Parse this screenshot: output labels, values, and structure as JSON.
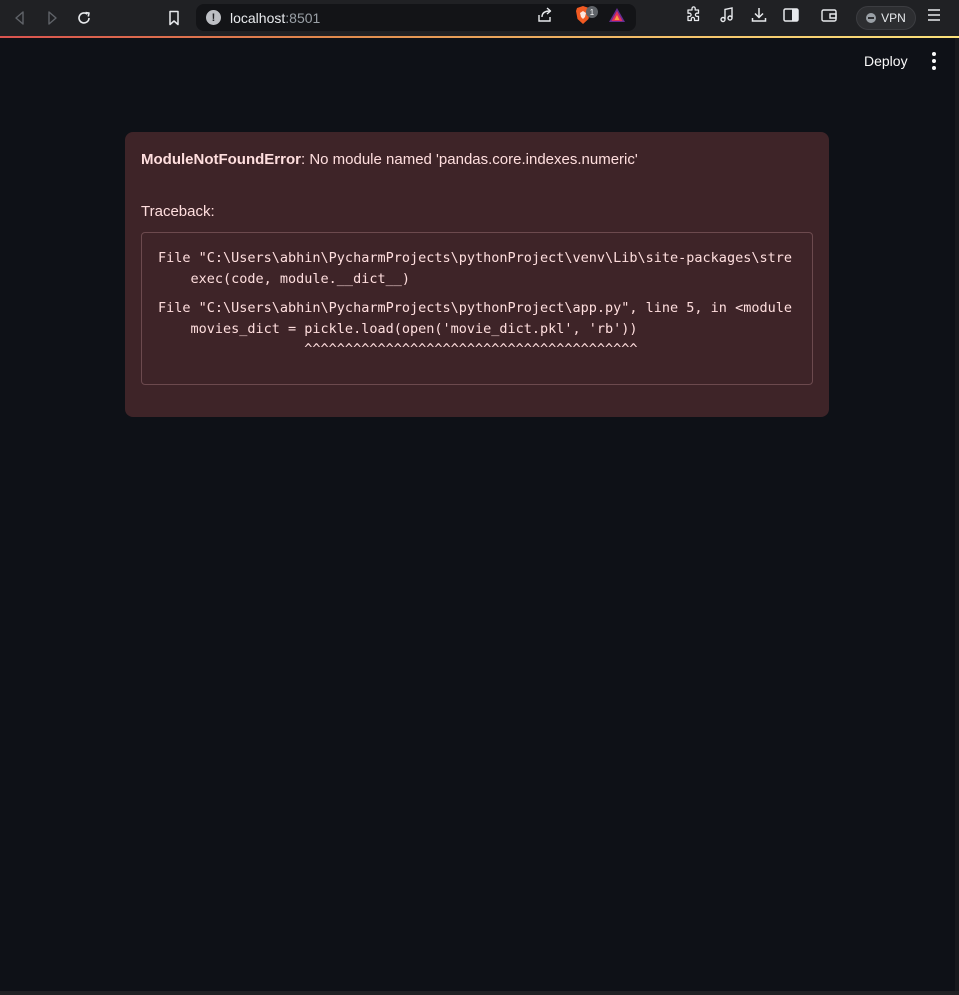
{
  "browser": {
    "url_host": "localhost",
    "url_port": ":8501",
    "brave_badge": "1",
    "vpn_label": "VPN",
    "colors": {
      "toolbar_bg": "#202124",
      "url_bg": "#131417",
      "accent_gradient": [
        "#d9534f",
        "#fbe27b"
      ]
    },
    "icons": [
      "back-icon",
      "forward-icon",
      "reload-icon",
      "bookmark-icon",
      "info-icon",
      "share-icon",
      "brave-shield-icon",
      "brave-rewards-icon",
      "extensions-icon",
      "media-icon",
      "download-icon",
      "sidebar-icon",
      "wallet-icon",
      "vpn-icon",
      "menu-icon"
    ]
  },
  "app": {
    "deploy_label": "Deploy",
    "colors": {
      "background": "#0e1117",
      "error_bg": "#3e2428",
      "error_text": "#ffdede"
    },
    "error": {
      "type": "ModuleNotFoundError",
      "message": ": No module named 'pandas.core.indexes.numeric'",
      "traceback_label": "Traceback:",
      "traceback_lines": [
        "File \"C:\\Users\\abhin\\PycharmProjects\\pythonProject\\venv\\Lib\\site-packages\\stre",
        "    exec(code, module.__dict__)",
        "File \"C:\\Users\\abhin\\PycharmProjects\\pythonProject\\app.py\", line 5, in <module",
        "    movies_dict = pickle.load(open('movie_dict.pkl', 'rb'))",
        "                  ^^^^^^^^^^^^^^^^^^^^^^^^^^^^^^^^^^^^^^^^^"
      ]
    }
  }
}
